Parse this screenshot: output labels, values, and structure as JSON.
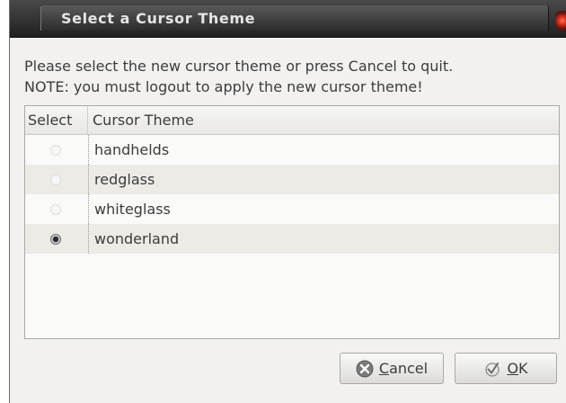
{
  "window": {
    "title": "Select a Cursor Theme"
  },
  "message": {
    "line1": "Please select the new cursor theme or press Cancel to quit.",
    "line2": "NOTE: you must logout to apply the new cursor theme!"
  },
  "table": {
    "headers": {
      "select": "Select",
      "theme": "Cursor Theme"
    },
    "rows": [
      {
        "label": "handhelds",
        "selected": false
      },
      {
        "label": "redglass",
        "selected": false
      },
      {
        "label": "whiteglass",
        "selected": false
      },
      {
        "label": "wonderland",
        "selected": true
      }
    ]
  },
  "buttons": {
    "cancel": {
      "mnemonic": "C",
      "rest": "ancel",
      "icon": "cancel-icon"
    },
    "ok": {
      "mnemonic": "O",
      "rest": "K",
      "icon": "checkmark-icon"
    }
  }
}
